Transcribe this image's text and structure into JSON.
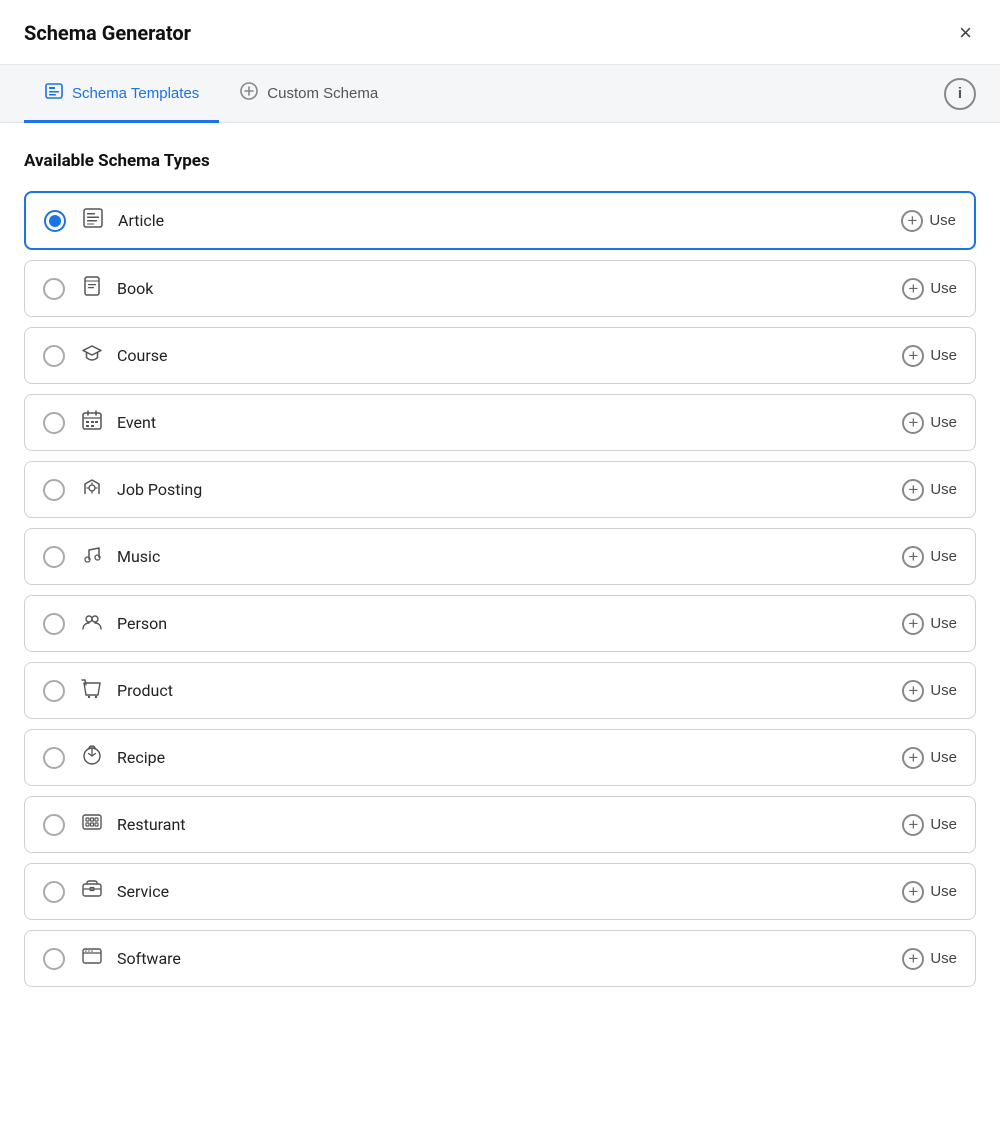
{
  "header": {
    "title": "Schema Generator",
    "close_label": "×"
  },
  "tabs": [
    {
      "id": "templates",
      "label": "Schema Templates",
      "active": true
    },
    {
      "id": "custom",
      "label": "Custom Schema",
      "active": false
    }
  ],
  "info_label": "i",
  "section": {
    "title": "Available Schema Types"
  },
  "schema_items": [
    {
      "id": "article",
      "label": "Article",
      "icon": "article",
      "selected": true,
      "use_label": "Use"
    },
    {
      "id": "book",
      "label": "Book",
      "icon": "book",
      "selected": false,
      "use_label": "Use"
    },
    {
      "id": "course",
      "label": "Course",
      "icon": "course",
      "selected": false,
      "use_label": "Use"
    },
    {
      "id": "event",
      "label": "Event",
      "icon": "event",
      "selected": false,
      "use_label": "Use"
    },
    {
      "id": "job-posting",
      "label": "Job Posting",
      "icon": "job",
      "selected": false,
      "use_label": "Use"
    },
    {
      "id": "music",
      "label": "Music",
      "icon": "music",
      "selected": false,
      "use_label": "Use"
    },
    {
      "id": "person",
      "label": "Person",
      "icon": "person",
      "selected": false,
      "use_label": "Use"
    },
    {
      "id": "product",
      "label": "Product",
      "icon": "product",
      "selected": false,
      "use_label": "Use"
    },
    {
      "id": "recipe",
      "label": "Recipe",
      "icon": "recipe",
      "selected": false,
      "use_label": "Use"
    },
    {
      "id": "restaurant",
      "label": "Resturant",
      "icon": "restaurant",
      "selected": false,
      "use_label": "Use"
    },
    {
      "id": "service",
      "label": "Service",
      "icon": "service",
      "selected": false,
      "use_label": "Use"
    },
    {
      "id": "software",
      "label": "Software",
      "icon": "software",
      "selected": false,
      "use_label": "Use"
    }
  ],
  "colors": {
    "accent": "#1a73e8"
  }
}
